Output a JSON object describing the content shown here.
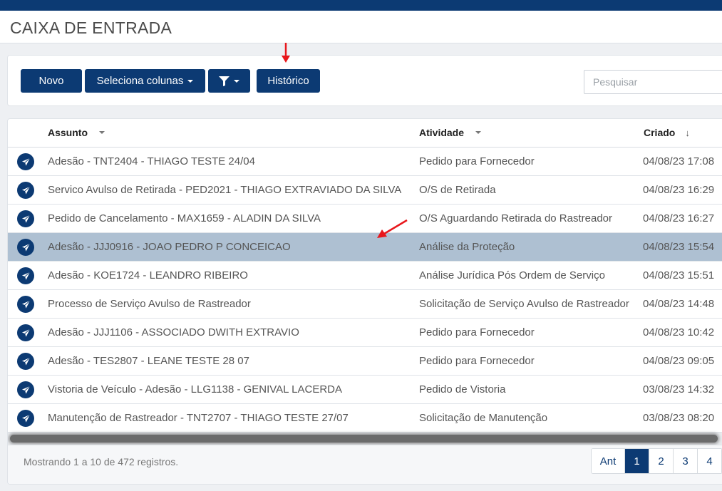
{
  "header": {
    "title": "CAIXA DE ENTRADA"
  },
  "toolbar": {
    "new_label": "Novo",
    "columns_label": "Seleciona colunas",
    "filter_icon": "funnel-icon",
    "history_label": "Histórico",
    "search_placeholder": "Pesquisar",
    "search_value": ""
  },
  "table": {
    "columns": [
      "Assunto",
      "Atividade",
      "Criado"
    ],
    "rows": [
      {
        "assunto": "Adesão - TNT2404 - THIAGO TESTE 24/04",
        "atividade": "Pedido para Fornecedor",
        "criado": "04/08/23 17:08",
        "selected": false
      },
      {
        "assunto": "Servico Avulso de Retirada - PED2021 - THIAGO EXTRAVIADO DA SILVA",
        "atividade": "O/S de Retirada",
        "criado": "04/08/23 16:29",
        "selected": false
      },
      {
        "assunto": "Pedido de Cancelamento - MAX1659 - ALADIN DA SILVA",
        "atividade": "O/S Aguardando Retirada do Rastreador",
        "criado": "04/08/23 16:27",
        "selected": false
      },
      {
        "assunto": "Adesão - JJJ0916 - JOAO PEDRO P CONCEICAO",
        "atividade": "Análise da Proteção",
        "criado": "04/08/23 15:54",
        "selected": true
      },
      {
        "assunto": "Adesão - KOE1724 - LEANDRO RIBEIRO",
        "atividade": "Análise Jurídica Pós Ordem de Serviço",
        "criado": "04/08/23 15:51",
        "selected": false
      },
      {
        "assunto": "Processo de Serviço Avulso de Rastreador",
        "atividade": "Solicitação de Serviço Avulso de Rastreador",
        "criado": "04/08/23 14:48",
        "selected": false
      },
      {
        "assunto": "Adesão - JJJ1106 - ASSOCIADO DWITH EXTRAVIO",
        "atividade": "Pedido para Fornecedor",
        "criado": "04/08/23 10:42",
        "selected": false
      },
      {
        "assunto": "Adesão - TES2807 - LEANE TESTE 28 07",
        "atividade": "Pedido para Fornecedor",
        "criado": "04/08/23 09:05",
        "selected": false
      },
      {
        "assunto": "Vistoria de Veículo - Adesão - LLG1138 - GENIVAL LACERDA",
        "atividade": "Pedido de Vistoria",
        "criado": "03/08/23 14:32",
        "selected": false
      },
      {
        "assunto": "Manutenção de Rastreador - TNT2707 - THIAGO TESTE 27/07",
        "atividade": "Solicitação de Manutenção",
        "criado": "03/08/23 08:20",
        "selected": false
      }
    ],
    "row_icon": "paper-plane-icon"
  },
  "footer": {
    "info": "Mostrando 1 a 10 de 472 registros.",
    "prev_label": "Ant",
    "pages": [
      "1",
      "2",
      "3",
      "4"
    ],
    "active_page": "1"
  },
  "colors": {
    "primary": "#0c3a73",
    "selected_row": "#aec0d2",
    "annotation_arrow": "#e8171c"
  }
}
